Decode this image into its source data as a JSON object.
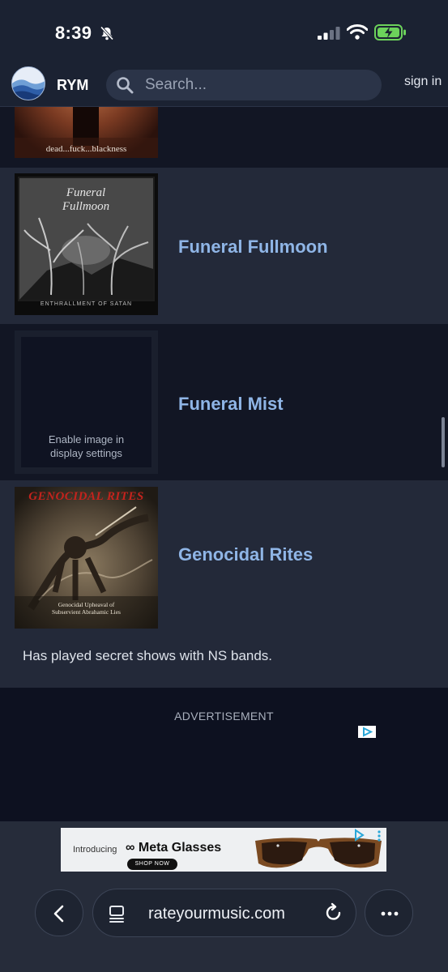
{
  "status_bar": {
    "time": "8:39",
    "icons": [
      "bell-slash-icon",
      "cellular-signal-icon",
      "wifi-icon",
      "battery-charging-icon"
    ]
  },
  "header": {
    "brand": "RYM",
    "search_placeholder": "Search...",
    "sign_in": "sign in"
  },
  "list": {
    "items": [
      {
        "cover_caption": "dead...fuck...blackness"
      },
      {
        "name": "Funeral Fullmoon",
        "cover_caption": "ENTHRALLMENT OF SATAN"
      },
      {
        "name": "Funeral Mist",
        "placeholder": "Enable image in\ndisplay settings"
      },
      {
        "name": "Genocidal Rites",
        "cover_title": "GENOCIDAL RITES",
        "cover_caption": "Genocidal Upheaval of\nSubservient Abrahamic Lies",
        "note": "Has played secret shows with NS bands."
      }
    ]
  },
  "ad": {
    "label": "ADVERTISEMENT"
  },
  "banner": {
    "intro": "Introducing",
    "brand": "Meta Glasses",
    "cta": "SHOP NOW"
  },
  "browser": {
    "url": "rateyourmusic.com"
  },
  "colors": {
    "link": "#8fb5e6",
    "row_dark": "#121624",
    "row_light": "#232939",
    "chrome": "#1b2232"
  }
}
